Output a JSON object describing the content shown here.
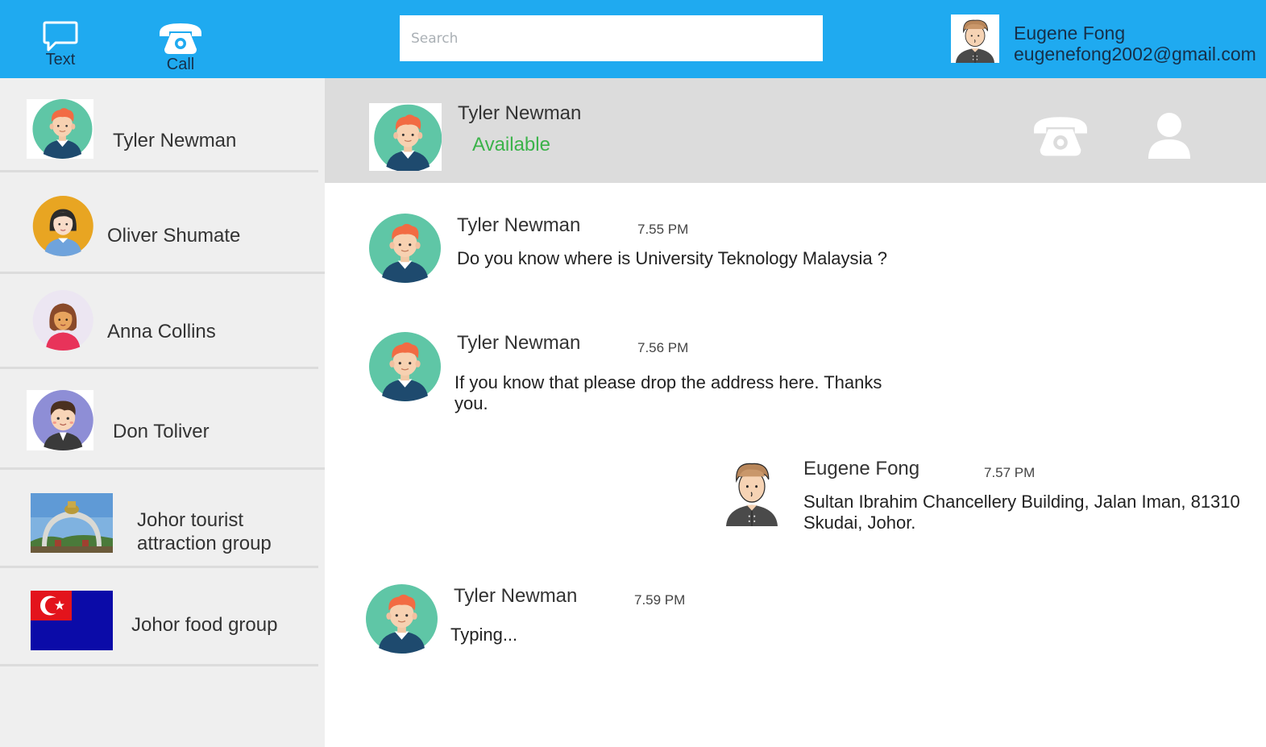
{
  "topbar": {
    "nav": [
      {
        "label": "Text",
        "icon": "chat-bubble-icon"
      },
      {
        "label": "Call",
        "icon": "phone-icon"
      }
    ],
    "search": {
      "placeholder": "Search",
      "value": ""
    },
    "user": {
      "name": "Eugene Fong",
      "email": "eugenefong2002@gmail.com",
      "avatar": "man-avatar"
    }
  },
  "contacts": [
    {
      "name": "Tyler Newman",
      "avatar": "red-hair-man-avatar"
    },
    {
      "name": "Oliver Shumate",
      "avatar": "woman-avatar"
    },
    {
      "name": "Anna Collins",
      "avatar": "woman-avatar"
    },
    {
      "name": "Don Toliver",
      "avatar": "boy-avatar"
    },
    {
      "name_line1": "Johor tourist",
      "name_line2": "attraction group",
      "avatar": "landmark-photo"
    },
    {
      "name": "Johor food group",
      "avatar": "johor-flag"
    }
  ],
  "chat": {
    "header": {
      "name": "Tyler Newman",
      "status": "Available",
      "call_icon": "phone-icon",
      "profile_icon": "user-icon"
    },
    "messages": [
      {
        "sender": "Tyler Newman",
        "time": "7.55 PM",
        "text": "Do you know where is University Teknology Malaysia ?"
      },
      {
        "sender": "Tyler Newman",
        "time": "7.56 PM",
        "text": "If you know that please drop the address here. Thanks you."
      },
      {
        "sender": "Eugene Fong",
        "time": "7.57 PM",
        "text": "Sultan Ibrahim Chancellery Building, Jalan Iman, 81310 Skudai, Johor."
      },
      {
        "sender": "Tyler Newman",
        "time": "7.59 PM",
        "text": "Typing..."
      }
    ]
  },
  "colors": {
    "topbar": "#1faaf0",
    "sidebar": "#efefef",
    "header": "#dcdcdc",
    "available": "#3bb34a"
  }
}
